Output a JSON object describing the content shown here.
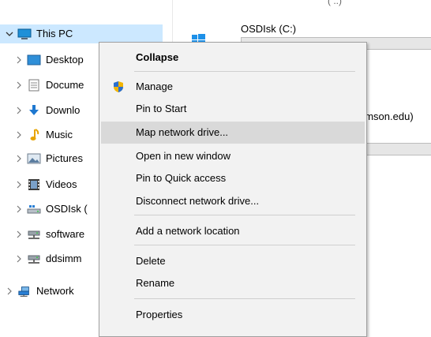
{
  "nav": {
    "items": [
      {
        "label": "This PC",
        "chevron": "expanded"
      },
      {
        "label": "Desktop",
        "chevron": "collapsed"
      },
      {
        "label": "Docume",
        "chevron": "collapsed"
      },
      {
        "label": "Downlo",
        "chevron": "collapsed"
      },
      {
        "label": "Music",
        "chevron": "collapsed"
      },
      {
        "label": "Pictures",
        "chevron": "collapsed"
      },
      {
        "label": "Videos",
        "chevron": "collapsed"
      },
      {
        "label": "OSDIsk (",
        "chevron": "collapsed"
      },
      {
        "label": "software",
        "chevron": "collapsed"
      },
      {
        "label": "ddsimm",
        "chevron": "collapsed"
      },
      {
        "label": "Network",
        "chevron": "collapsed"
      }
    ]
  },
  "content": {
    "drive_label": "OSDIsk (C:)",
    "network_fragment": "emson.edu)",
    "top_fragment": "( ..)"
  },
  "menu": {
    "collapse": "Collapse",
    "manage": "Manage",
    "pin_start": "Pin to Start",
    "map_drive": "Map network drive...",
    "open_window": "Open in new window",
    "pin_quick": "Pin to Quick access",
    "disconnect": "Disconnect network drive...",
    "add_location": "Add a network location",
    "delete": "Delete",
    "rename": "Rename",
    "properties": "Properties"
  },
  "colors": {
    "selected_bg": "#cce8ff",
    "menu_bg": "#f2f2f2",
    "menu_highlight": "#d9d9d9"
  }
}
